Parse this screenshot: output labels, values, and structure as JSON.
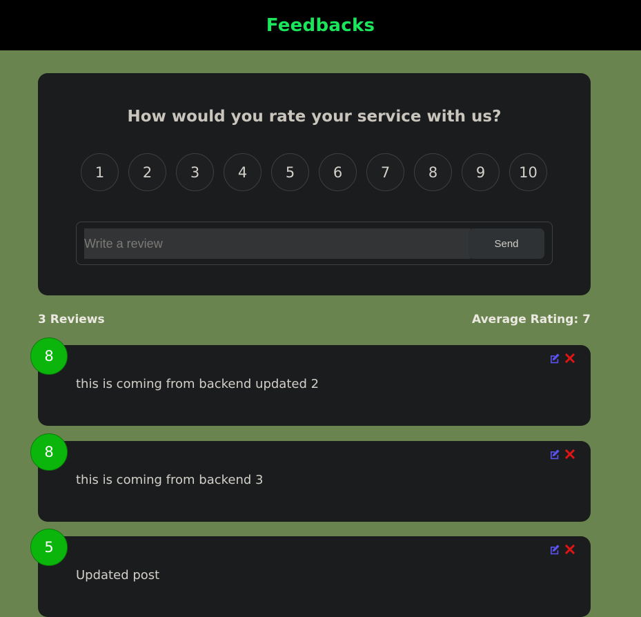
{
  "header": {
    "title": "Feedbacks"
  },
  "rating_card": {
    "question": "How would you rate your service with us?",
    "options": [
      "1",
      "2",
      "3",
      "4",
      "5",
      "6",
      "7",
      "8",
      "9",
      "10"
    ],
    "input_placeholder": "Write a review",
    "input_value": "",
    "send_label": "Send"
  },
  "stats": {
    "count_label": "3 Reviews",
    "average_label": "Average Rating: 7"
  },
  "reviews": [
    {
      "rating": "8",
      "text": "this is coming from backend updated 2",
      "edit_icon": "edit-icon",
      "delete_icon": "close-icon"
    },
    {
      "rating": "8",
      "text": "this is coming from backend 3",
      "edit_icon": "edit-icon",
      "delete_icon": "close-icon"
    },
    {
      "rating": "5",
      "text": "Updated post",
      "edit_icon": "edit-icon",
      "delete_icon": "close-icon"
    }
  ],
  "colors": {
    "page_background": "#6a844f",
    "header_background": "#000000",
    "title_accent": "#1ae65c",
    "card_background": "#1b1c1e",
    "rating_badge": "#0bb50b",
    "edit_icon": "#5b53f0",
    "delete_icon": "#e11414"
  }
}
